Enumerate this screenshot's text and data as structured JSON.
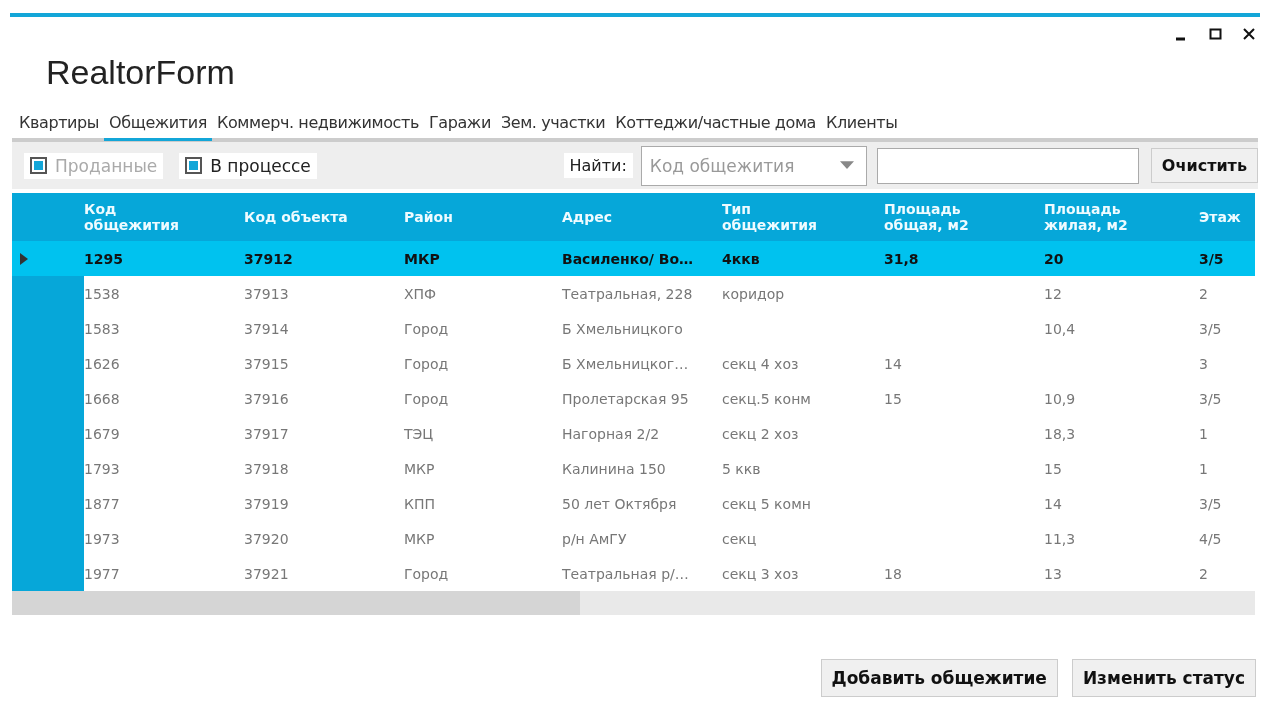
{
  "window": {
    "title": "RealtorForm",
    "controls": [
      {
        "kind": "minimize"
      },
      {
        "kind": "maximize"
      },
      {
        "kind": "close"
      }
    ]
  },
  "tabs": [
    {
      "label": "Квартиры",
      "selected": false
    },
    {
      "label": "Общежития",
      "selected": true
    },
    {
      "label": "Коммерч. недвижимость",
      "selected": false
    },
    {
      "label": "Гаражи",
      "selected": false
    },
    {
      "label": "Зем. участки",
      "selected": false
    },
    {
      "label": "Коттеджи/частные дома",
      "selected": false
    },
    {
      "label": "Клиенты",
      "selected": false
    }
  ],
  "filters": [
    {
      "label": "Проданные",
      "checked": true,
      "disabled": true
    },
    {
      "label": "В процессе",
      "checked": true,
      "disabled": false
    }
  ],
  "search": {
    "label": "Найти:",
    "field_dropdown": {
      "placeholder": "Код общежития"
    },
    "clear_button": "Очистить"
  },
  "table": {
    "columns": [
      "Код общежития",
      "Код объекта",
      "Район",
      "Адрес",
      "Тип общежития",
      "Площадь общая, м2",
      "Площадь жилая, м2",
      "Этаж"
    ],
    "rows": [
      {
        "selected": true,
        "cells": [
          "1295",
          "37912",
          "МКР",
          "Василенко/ Во…",
          "4ккв",
          "31,8",
          "20",
          "3/5"
        ]
      },
      {
        "selected": false,
        "cells": [
          "1538",
          "37913",
          "ХПФ",
          "Театральная, 228",
          "коридор",
          "",
          "12",
          "2"
        ]
      },
      {
        "selected": false,
        "cells": [
          "1583",
          "37914",
          "Город",
          "Б Хмельницкого",
          "",
          "",
          "10,4",
          "3/5"
        ]
      },
      {
        "selected": false,
        "cells": [
          "1626",
          "37915",
          "Город",
          "Б Хмельницког…",
          "секц 4 хоз",
          "14",
          "",
          "3"
        ]
      },
      {
        "selected": false,
        "cells": [
          "1668",
          "37916",
          "Город",
          "Пролетарская 95",
          "секц.5 конм",
          "15",
          "10,9",
          "3/5"
        ]
      },
      {
        "selected": false,
        "cells": [
          "1679",
          "37917",
          "ТЭЦ",
          "Нагорная 2/2",
          "секц 2 хоз",
          "",
          "18,3",
          "1"
        ]
      },
      {
        "selected": false,
        "cells": [
          "1793",
          "37918",
          "МКР",
          "Калинина 150",
          "5 ккв",
          "",
          "15",
          "1"
        ]
      },
      {
        "selected": false,
        "cells": [
          "1877",
          "37919",
          "КПП",
          "50 лет Октября",
          "секц 5 комн",
          "",
          "14",
          "3/5"
        ]
      },
      {
        "selected": false,
        "cells": [
          "1973",
          "37920",
          "МКР",
          "р/н АмГУ",
          "секц",
          "",
          "11,3",
          "4/5"
        ]
      },
      {
        "selected": false,
        "cells": [
          "1977",
          "37921",
          "Город",
          "Театральная р/…",
          "секц 3 хоз",
          "18",
          "13",
          "2"
        ]
      }
    ]
  },
  "buttons": [
    "Добавить общежитие",
    "Изменить статус"
  ]
}
